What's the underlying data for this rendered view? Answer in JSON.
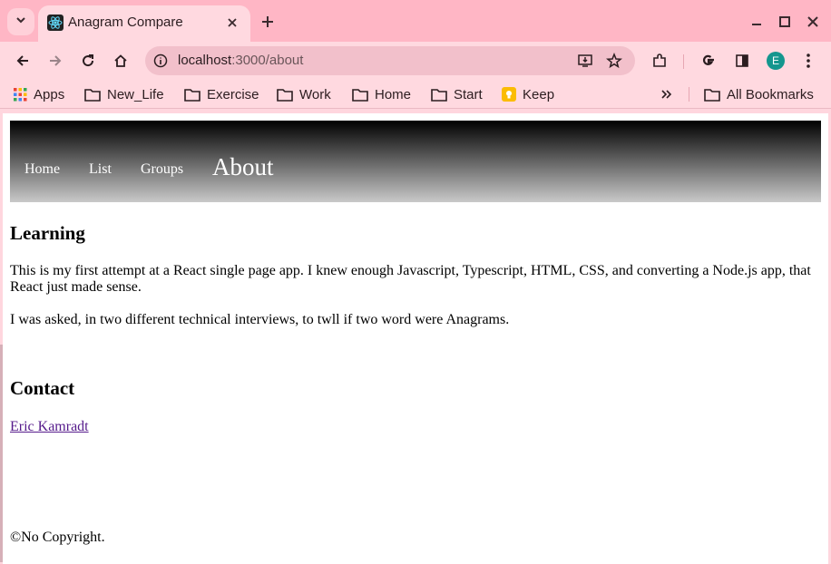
{
  "browser": {
    "tab": {
      "title": "Anagram Compare"
    },
    "url": {
      "host": "localhost",
      "rest": ":3000/about"
    },
    "profile_letter": "E",
    "colors": {
      "frame": "#ffb6c5",
      "toolbar": "#ffd9e0",
      "omnibox": "#f2c0cb",
      "profile": "#14968e"
    },
    "bookmarks": [
      {
        "label": "Apps",
        "icon": "apps-grid-icon"
      },
      {
        "label": "New_Life",
        "icon": "folder-icon"
      },
      {
        "label": "Exercise",
        "icon": "folder-icon"
      },
      {
        "label": "Work",
        "icon": "folder-icon"
      },
      {
        "label": "Home",
        "icon": "folder-icon"
      },
      {
        "label": "Start",
        "icon": "folder-icon"
      },
      {
        "label": "Keep",
        "icon": "keep-icon"
      }
    ],
    "all_bookmarks": "All Bookmarks"
  },
  "page": {
    "nav": [
      "Home",
      "List",
      "Groups"
    ],
    "nav_active": "About",
    "learning": {
      "heading": "Learning",
      "p1": "This is my first attempt at a React single page app. I knew enough Javascript, Typescript, HTML, CSS, and converting a Node.js app, that React just made sense.",
      "p2": "I was asked, in two different technical interviews, to twll if two word were Anagrams."
    },
    "contact": {
      "heading": "Contact",
      "link": "Eric Kamradt"
    },
    "footer": "©No Copyright."
  }
}
